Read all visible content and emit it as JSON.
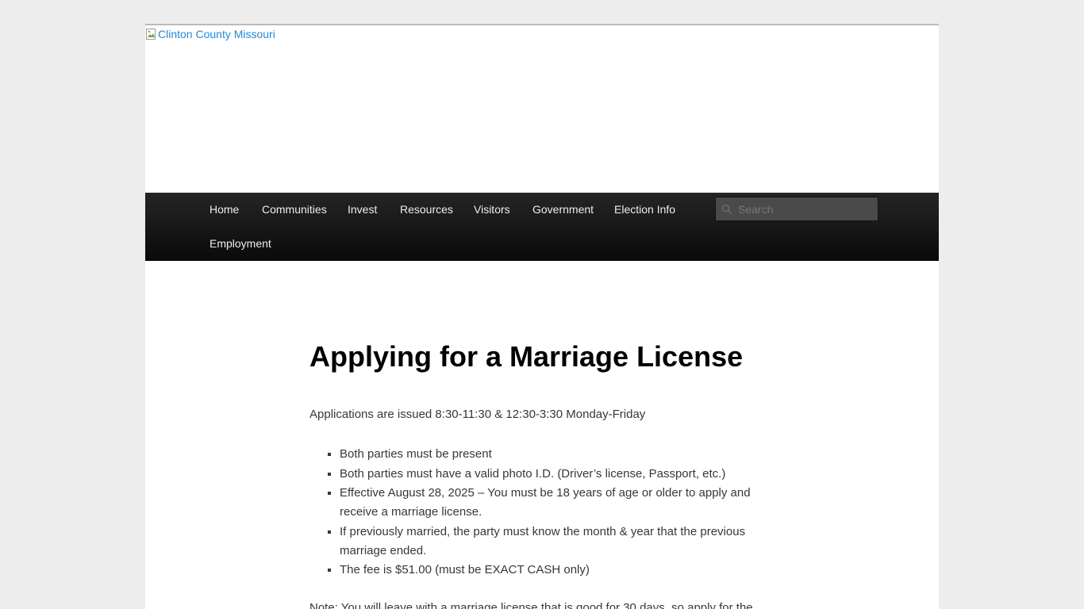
{
  "header": {
    "logo_alt": "Clinton County Missouri"
  },
  "nav": {
    "items": [
      {
        "label": "Home"
      },
      {
        "label": "Communities"
      },
      {
        "label": "Invest"
      },
      {
        "label": "Resources"
      },
      {
        "label": "Visitors"
      },
      {
        "label": "Government"
      },
      {
        "label": "Election Info"
      },
      {
        "label": "Employment"
      }
    ],
    "search_placeholder": "Search"
  },
  "article": {
    "title": "Applying for a Marriage License",
    "intro": "Applications are issued 8:30-11:30 & 12:30-3:30 Monday-Friday",
    "requirements": [
      "Both parties must be present",
      "Both parties must have a valid photo I.D. (Driver’s license, Passport, etc.)",
      "Effective August 28, 2025  – You must be 18 years of age or older to apply and receive a marriage license.",
      "If previously married, the party must know the month & year that the previous marriage ended.",
      "The fee is $51.00 (must be EXACT CASH only)"
    ],
    "note": "Note: You will leave with a marriage license that is good for 30 days, so apply for the"
  },
  "colors": {
    "page_background": "#ededed",
    "link": "#1b8be0",
    "nav_background": "#1a1a1a",
    "title": "#000000",
    "body_text": "#373737"
  }
}
